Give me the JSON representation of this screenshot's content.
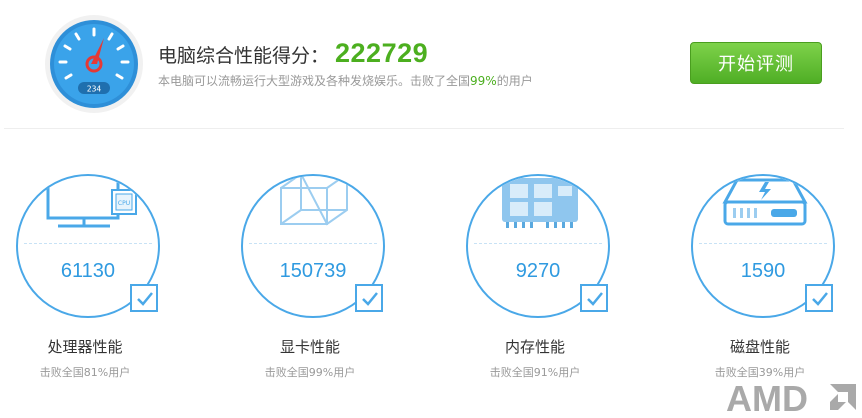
{
  "header": {
    "title": "电脑综合性能得分：",
    "score": "222729",
    "desc_before": "本电脑可以流畅运行大型游戏及各种发烧娱乐。击败了全国",
    "desc_pct": "99%",
    "desc_after": "的用户",
    "gauge_readout": "234",
    "start_button": "开始评测"
  },
  "cards": [
    {
      "value": "61130",
      "name": "处理器性能",
      "sub": "击败全国81%用户",
      "icon_label": "CPU",
      "icon": "monitor-cpu-icon"
    },
    {
      "value": "150739",
      "name": "显卡性能",
      "sub": "击败全国99%用户",
      "icon": "cube-icon"
    },
    {
      "value": "9270",
      "name": "内存性能",
      "sub": "击败全国91%用户",
      "icon": "memory-chip-icon"
    },
    {
      "value": "1590",
      "name": "磁盘性能",
      "sub": "击败全国39%用户",
      "icon": "hard-disk-icon"
    }
  ],
  "brand": {
    "logo_text": "AMD"
  },
  "colors": {
    "accent_blue": "#2f9ae0",
    "score_green": "#4caf1f",
    "button_green": "#5cbf2a"
  }
}
